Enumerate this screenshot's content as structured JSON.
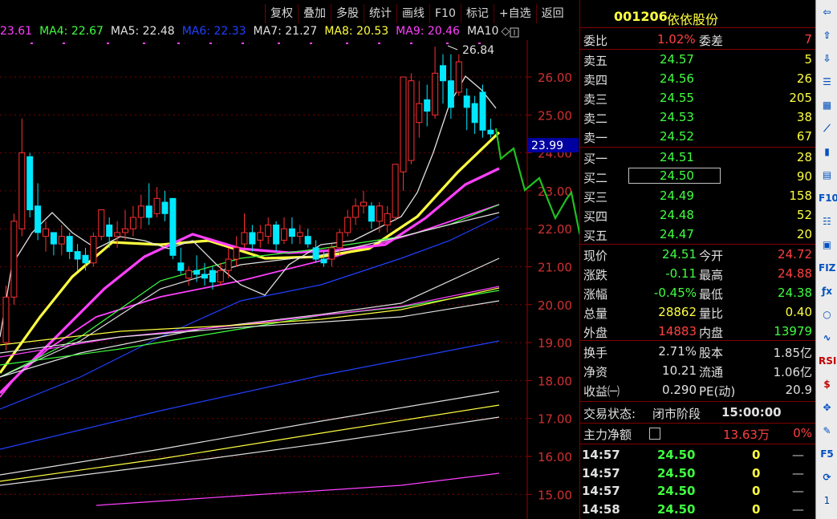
{
  "toolbar": [
    "复权",
    "叠加",
    "多股",
    "统计",
    "画线",
    "F10",
    "标记",
    "+自选",
    "返回"
  ],
  "ma_legend": [
    {
      "label": "23.61",
      "color": "#ff40ff"
    },
    {
      "label": "MA4: 22.67",
      "color": "#40ff40"
    },
    {
      "label": "MA5: 22.48",
      "color": "#e0e0e0"
    },
    {
      "label": "MA6: 22.33",
      "color": "#2040ff"
    },
    {
      "label": "MA7: 21.27",
      "color": "#e0e0e0"
    },
    {
      "label": "MA8: 20.53",
      "color": "#ffff40"
    },
    {
      "label": "MA9: 20.46",
      "color": "#ff40ff"
    },
    {
      "label": "MA10",
      "color": "#e0e0e0"
    }
  ],
  "price_axis": [
    "26.00",
    "25.00",
    "24.00",
    "23.00",
    "22.00",
    "21.00",
    "20.00",
    "19.00",
    "18.00",
    "17.00",
    "16.00",
    "15.00"
  ],
  "current_price_tag": "23.99",
  "high_annotation": "26.84",
  "stock": {
    "code": "001206",
    "name": "依依股份"
  },
  "order_book": {
    "weibi_label": "委比",
    "weibi_value": "1.02%",
    "weicha_label": "委差",
    "weicha_value": "7",
    "sells": [
      {
        "label": "卖五",
        "price": "24.57",
        "vol": "5"
      },
      {
        "label": "卖四",
        "price": "24.56",
        "vol": "26"
      },
      {
        "label": "卖三",
        "price": "24.55",
        "vol": "205"
      },
      {
        "label": "卖二",
        "price": "24.53",
        "vol": "38"
      },
      {
        "label": "卖一",
        "price": "24.52",
        "vol": "67"
      }
    ],
    "buys": [
      {
        "label": "买一",
        "price": "24.51",
        "vol": "28"
      },
      {
        "label": "买二",
        "price": "24.50",
        "vol": "90"
      },
      {
        "label": "买三",
        "price": "24.49",
        "vol": "158"
      },
      {
        "label": "买四",
        "price": "24.48",
        "vol": "52"
      },
      {
        "label": "买五",
        "price": "24.47",
        "vol": "20"
      }
    ]
  },
  "quote": [
    {
      "l1": "现价",
      "v1": "24.51",
      "c1": "#40ff40",
      "l2": "今开",
      "v2": "24.72",
      "c2": "#ff4040"
    },
    {
      "l1": "涨跌",
      "v1": "-0.11",
      "c1": "#40ff40",
      "l2": "最高",
      "v2": "24.88",
      "c2": "#ff4040"
    },
    {
      "l1": "涨幅",
      "v1": "-0.45%",
      "c1": "#40ff40",
      "l2": "最低",
      "v2": "24.38",
      "c2": "#40ff40"
    },
    {
      "l1": "总量",
      "v1": "28862",
      "c1": "#ffff40",
      "l2": "量比",
      "v2": "0.40",
      "c2": "#ffff40"
    },
    {
      "l1": "外盘",
      "v1": "14883",
      "c1": "#ff4040",
      "l2": "内盘",
      "v2": "13979",
      "c2": "#40ff40"
    }
  ],
  "fundamentals": [
    {
      "l1": "换手",
      "v1": "2.71%",
      "l2": "股本",
      "v2": "1.85亿"
    },
    {
      "l1": "净资",
      "v1": "10.21",
      "l2": "流通",
      "v2": "1.06亿"
    },
    {
      "l1": "收益㈠",
      "v1": "0.290",
      "l2": "PE(动)",
      "v2": "20.9"
    }
  ],
  "status": {
    "label": "交易状态:",
    "phase": "闭市阶段",
    "time": "15:00:00"
  },
  "main_net": {
    "label": "主力净额",
    "value": "13.63万",
    "pct": "0%"
  },
  "ticks": [
    {
      "time": "14:57",
      "price": "24.50",
      "vol": "0",
      "dir": "—"
    },
    {
      "time": "14:57",
      "price": "24.50",
      "vol": "0",
      "dir": "—"
    },
    {
      "time": "14:57",
      "price": "24.50",
      "vol": "0",
      "dir": "—"
    },
    {
      "time": "14:58",
      "price": "24.50",
      "vol": "0",
      "dir": "—"
    }
  ],
  "side_icons": [
    "arrow-left",
    "arrow-up",
    "arrow-down",
    "list",
    "grid",
    "line-chart",
    "candle",
    "table",
    "F10",
    "news",
    "info",
    "FIZ",
    "fx",
    "circle",
    "wave",
    "RSI",
    "dollar",
    "move",
    "pen",
    "F5",
    "refresh",
    "1"
  ],
  "side_text": {
    "F10": "F10",
    "FIZ": "FIZ",
    "fx": "ƒx",
    "RSI": "RSI",
    "dollar": "$",
    "F5": "F5",
    "1": "1"
  },
  "candles": [
    {
      "o": 19.0,
      "c": 20.2,
      "h": 20.5,
      "l": 18.8
    },
    {
      "o": 20.2,
      "c": 22.2,
      "h": 22.4,
      "l": 20.0
    },
    {
      "o": 22.0,
      "c": 24.0,
      "h": 24.9,
      "l": 21.8
    },
    {
      "o": 23.9,
      "c": 22.5,
      "h": 24.0,
      "l": 22.3
    },
    {
      "o": 22.6,
      "c": 21.9,
      "h": 23.2,
      "l": 21.7
    },
    {
      "o": 21.8,
      "c": 22.0,
      "h": 22.2,
      "l": 21.4
    },
    {
      "o": 21.9,
      "c": 21.6,
      "h": 21.9,
      "l": 21.3
    },
    {
      "o": 21.6,
      "c": 21.8,
      "h": 22.1,
      "l": 21.3
    },
    {
      "o": 21.8,
      "c": 21.4,
      "h": 21.9,
      "l": 21.2
    },
    {
      "o": 21.4,
      "c": 21.2,
      "h": 21.6,
      "l": 20.9
    },
    {
      "o": 21.3,
      "c": 21.1,
      "h": 21.5,
      "l": 20.9
    },
    {
      "o": 21.1,
      "c": 21.8,
      "h": 21.9,
      "l": 21.0
    },
    {
      "o": 21.8,
      "c": 22.5,
      "h": 22.5,
      "l": 21.7
    },
    {
      "o": 22.1,
      "c": 21.8,
      "h": 22.3,
      "l": 21.5
    },
    {
      "o": 21.8,
      "c": 21.9,
      "h": 22.2,
      "l": 21.5
    },
    {
      "o": 21.9,
      "c": 22.0,
      "h": 22.5,
      "l": 21.7
    },
    {
      "o": 22.0,
      "c": 22.3,
      "h": 22.6,
      "l": 21.8
    },
    {
      "o": 22.3,
      "c": 22.6,
      "h": 22.9,
      "l": 22.0
    },
    {
      "o": 22.6,
      "c": 22.3,
      "h": 23.2,
      "l": 22.1
    },
    {
      "o": 22.4,
      "c": 22.8,
      "h": 23.1,
      "l": 22.3
    },
    {
      "o": 22.7,
      "c": 22.4,
      "h": 23.0,
      "l": 22.2
    },
    {
      "o": 22.8,
      "c": 21.3,
      "h": 22.8,
      "l": 21.2
    },
    {
      "o": 21.1,
      "c": 20.9,
      "h": 21.5,
      "l": 20.8
    },
    {
      "o": 20.7,
      "c": 20.9,
      "h": 21.0,
      "l": 20.5
    },
    {
      "o": 20.9,
      "c": 20.8,
      "h": 21.3,
      "l": 20.6
    },
    {
      "o": 20.8,
      "c": 20.7,
      "h": 21.1,
      "l": 20.5
    },
    {
      "o": 20.9,
      "c": 20.6,
      "h": 21.0,
      "l": 20.4
    },
    {
      "o": 20.6,
      "c": 20.9,
      "h": 21.1,
      "l": 20.5
    },
    {
      "o": 20.9,
      "c": 21.2,
      "h": 21.5,
      "l": 20.7
    },
    {
      "o": 21.2,
      "c": 21.5,
      "h": 21.8,
      "l": 21.0
    },
    {
      "o": 21.6,
      "c": 21.9,
      "h": 22.4,
      "l": 21.5
    },
    {
      "o": 21.9,
      "c": 21.6,
      "h": 22.1,
      "l": 21.4
    },
    {
      "o": 21.7,
      "c": 21.9,
      "h": 22.1,
      "l": 21.5
    },
    {
      "o": 21.8,
      "c": 22.1,
      "h": 22.3,
      "l": 21.6
    },
    {
      "o": 22.1,
      "c": 21.6,
      "h": 22.2,
      "l": 21.4
    },
    {
      "o": 21.7,
      "c": 22.0,
      "h": 22.3,
      "l": 21.6
    },
    {
      "o": 22.0,
      "c": 21.8,
      "h": 22.3,
      "l": 21.6
    },
    {
      "o": 21.8,
      "c": 21.9,
      "h": 22.1,
      "l": 21.6
    },
    {
      "o": 21.8,
      "c": 21.6,
      "h": 22.0,
      "l": 21.5
    },
    {
      "o": 21.5,
      "c": 21.2,
      "h": 21.7,
      "l": 21.1
    },
    {
      "o": 21.2,
      "c": 21.1,
      "h": 21.4,
      "l": 21.0
    },
    {
      "o": 21.2,
      "c": 21.5,
      "h": 21.6,
      "l": 21.0
    },
    {
      "o": 21.5,
      "c": 21.9,
      "h": 22.0,
      "l": 21.3
    },
    {
      "o": 21.9,
      "c": 22.3,
      "h": 22.5,
      "l": 21.8
    },
    {
      "o": 22.3,
      "c": 22.6,
      "h": 22.8,
      "l": 22.1
    },
    {
      "o": 22.6,
      "c": 22.7,
      "h": 23.0,
      "l": 22.4
    },
    {
      "o": 22.6,
      "c": 22.2,
      "h": 22.7,
      "l": 22.0
    },
    {
      "o": 22.2,
      "c": 22.6,
      "h": 22.7,
      "l": 21.9
    },
    {
      "o": 22.1,
      "c": 22.4,
      "h": 22.6,
      "l": 21.9
    },
    {
      "o": 22.3,
      "c": 23.7,
      "h": 23.7,
      "l": 22.2
    },
    {
      "o": 23.5,
      "c": 26.0,
      "h": 26.0,
      "l": 23.0
    },
    {
      "o": 23.8,
      "c": 25.9,
      "h": 26.1,
      "l": 23.7
    },
    {
      "o": 24.8,
      "c": 25.3,
      "h": 25.9,
      "l": 24.4
    },
    {
      "o": 25.4,
      "c": 25.1,
      "h": 25.8,
      "l": 24.7
    },
    {
      "o": 25.0,
      "c": 26.1,
      "h": 26.8,
      "l": 24.9
    },
    {
      "o": 26.3,
      "c": 25.9,
      "h": 26.6,
      "l": 25.3
    },
    {
      "o": 25.9,
      "c": 25.2,
      "h": 26.6,
      "l": 24.9
    },
    {
      "o": 25.6,
      "c": 26.4,
      "h": 26.6,
      "l": 25.5
    },
    {
      "o": 25.5,
      "c": 25.2,
      "h": 25.7,
      "l": 24.6
    },
    {
      "o": 25.3,
      "c": 24.8,
      "h": 25.5,
      "l": 24.5
    },
    {
      "o": 25.6,
      "c": 24.6,
      "h": 25.8,
      "l": 24.4
    },
    {
      "o": 24.6,
      "c": 24.5,
      "h": 24.9,
      "l": 24.4
    }
  ]
}
